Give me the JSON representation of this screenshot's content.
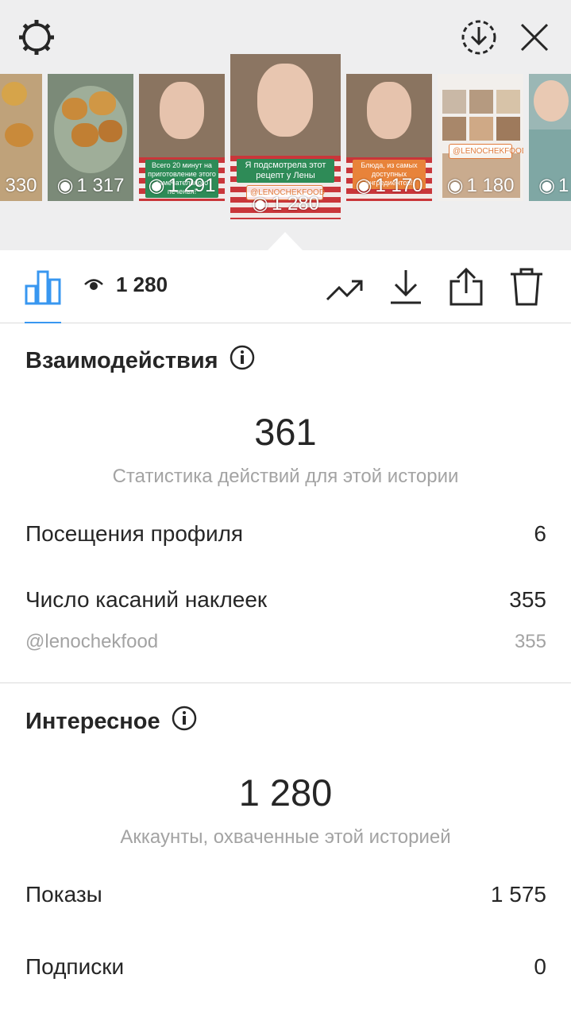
{
  "header": {
    "settings_icon": "gear-icon",
    "download_all_icon": "download-circle-icon",
    "close_icon": "close-icon"
  },
  "stories": [
    {
      "views": "330",
      "caption": ""
    },
    {
      "views": "1 317",
      "caption": ""
    },
    {
      "views": "1 291",
      "caption": "Всего 20 минут на приготовление этого замечательного печенья!"
    },
    {
      "views": "1 280",
      "caption": "Я подсмотрела этот рецепт у Лены",
      "tag": "@LENOCHEKFOOD",
      "active": true
    },
    {
      "views": "1 170",
      "caption": "Блюда, из самых доступных ингредиентов!"
    },
    {
      "views": "1 180",
      "caption": "",
      "tag": "@LENOCHEKFOOD"
    },
    {
      "views": "1",
      "caption": ""
    }
  ],
  "toolbar": {
    "views_count": "1 280",
    "icons": [
      "bar-chart-icon",
      "eye-icon",
      "trending-icon",
      "download-icon",
      "share-icon",
      "trash-icon"
    ]
  },
  "interactions": {
    "title": "Взаимодействия",
    "total": "361",
    "caption": "Статистика действий для этой истории",
    "rows": [
      {
        "label": "Посещения профиля",
        "value": "6"
      },
      {
        "label": "Число касаний наклеек",
        "value": "355"
      }
    ],
    "sub_row": {
      "label": "@lenochekfood",
      "value": "355"
    }
  },
  "discovery": {
    "title": "Интересное",
    "total": "1 280",
    "caption": "Аккаунты, охваченные этой историей",
    "rows": [
      {
        "label": "Показы",
        "value": "1 575"
      },
      {
        "label": "Подписки",
        "value": "0"
      }
    ]
  },
  "colors": {
    "accent": "#3897f0",
    "text": "#262626",
    "muted": "#a3a3a3",
    "divider": "#dbdbdb",
    "top_bg": "#eeeeef"
  }
}
